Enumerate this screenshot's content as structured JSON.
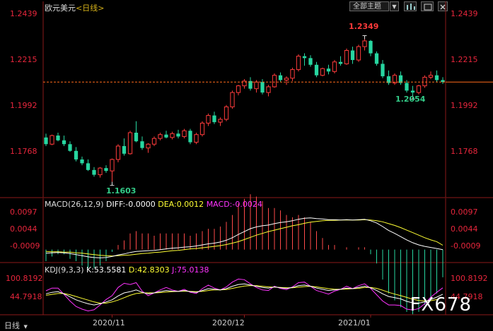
{
  "header": {
    "pair": "欧元美元",
    "period": "<日线>",
    "dropdown_label": "全部主题",
    "dropdown_arrow": "▼",
    "icons": [
      "chart-icon",
      "maximize-icon",
      "close-icon"
    ]
  },
  "chart_data": [
    {
      "type": "candlestick",
      "title": "欧元美元<日线>",
      "yticks": [
        "1.2439",
        "1.2215",
        "1.1992",
        "1.1768"
      ],
      "ylim": [
        1.155,
        1.248
      ],
      "current_price": 1.2125,
      "annotations": [
        {
          "label": "1.2349",
          "value": 1.2349,
          "color": "#ff3a3a"
        },
        {
          "label": "1.2054",
          "value": 1.2054,
          "color": "#33cc88"
        },
        {
          "label": "1.1603",
          "value": 1.1603,
          "color": "#33cc88"
        }
      ],
      "candles": [
        [
          1.1835,
          1.1855,
          1.179,
          1.18
        ],
        [
          1.18,
          1.185,
          1.1795,
          1.1845
        ],
        [
          1.1845,
          1.186,
          1.1815,
          1.182
        ],
        [
          1.182,
          1.1845,
          1.179,
          1.18
        ],
        [
          1.18,
          1.1815,
          1.176,
          1.1765
        ],
        [
          1.1765,
          1.1785,
          1.171,
          1.172
        ],
        [
          1.172,
          1.1735,
          1.169,
          1.17
        ],
        [
          1.17,
          1.172,
          1.166,
          1.1665
        ],
        [
          1.1665,
          1.168,
          1.163,
          1.164
        ],
        [
          1.164,
          1.168,
          1.1625,
          1.1675
        ],
        [
          1.1675,
          1.169,
          1.165,
          1.166
        ],
        [
          1.166,
          1.1725,
          1.1603,
          1.172
        ],
        [
          1.172,
          1.18,
          1.1705,
          1.179
        ],
        [
          1.179,
          1.183,
          1.174,
          1.175
        ],
        [
          1.175,
          1.187,
          1.1745,
          1.186
        ],
        [
          1.186,
          1.192,
          1.181,
          1.1815
        ],
        [
          1.1815,
          1.184,
          1.177,
          1.178
        ],
        [
          1.178,
          1.1805,
          1.1755,
          1.18
        ],
        [
          1.18,
          1.184,
          1.179,
          1.183
        ],
        [
          1.183,
          1.186,
          1.182,
          1.185
        ],
        [
          1.185,
          1.187,
          1.183,
          1.1835
        ],
        [
          1.1835,
          1.1865,
          1.1825,
          1.1855
        ],
        [
          1.1855,
          1.1875,
          1.183,
          1.184
        ],
        [
          1.184,
          1.188,
          1.183,
          1.187
        ],
        [
          1.187,
          1.188,
          1.18,
          1.181
        ],
        [
          1.181,
          1.186,
          1.18,
          1.185
        ],
        [
          1.185,
          1.192,
          1.184,
          1.191
        ],
        [
          1.191,
          1.196,
          1.1895,
          1.195
        ],
        [
          1.195,
          1.197,
          1.1905,
          1.1915
        ],
        [
          1.1915,
          1.194,
          1.1895,
          1.193
        ],
        [
          1.193,
          1.2005,
          1.192,
          1.1995
        ],
        [
          1.1995,
          1.208,
          1.1985,
          1.207
        ],
        [
          1.207,
          1.211,
          1.2055,
          1.2105
        ],
        [
          1.2105,
          1.214,
          1.209,
          1.213
        ],
        [
          1.213,
          1.215,
          1.208,
          1.209
        ],
        [
          1.209,
          1.2135,
          1.207,
          1.2125
        ],
        [
          1.2125,
          1.214,
          1.206,
          1.207
        ],
        [
          1.207,
          1.211,
          1.205,
          1.21
        ],
        [
          1.21,
          1.217,
          1.2095,
          1.216
        ],
        [
          1.216,
          1.2175,
          1.2125,
          1.2135
        ],
        [
          1.2135,
          1.2155,
          1.211,
          1.2145
        ],
        [
          1.2145,
          1.22,
          1.213,
          1.219
        ],
        [
          1.219,
          1.227,
          1.218,
          1.226
        ],
        [
          1.226,
          1.2275,
          1.221,
          1.225
        ],
        [
          1.225,
          1.2265,
          1.2205,
          1.2215
        ],
        [
          1.2215,
          1.223,
          1.215,
          1.216
        ],
        [
          1.216,
          1.22,
          1.2155,
          1.2195
        ],
        [
          1.2195,
          1.2215,
          1.2165,
          1.218
        ],
        [
          1.218,
          1.224,
          1.217,
          1.223
        ],
        [
          1.223,
          1.226,
          1.221,
          1.222
        ],
        [
          1.222,
          1.23,
          1.2215,
          1.229
        ],
        [
          1.229,
          1.231,
          1.222,
          1.224
        ],
        [
          1.224,
          1.232,
          1.223,
          1.231
        ],
        [
          1.231,
          1.2349,
          1.229,
          1.234
        ],
        [
          1.234,
          1.2345,
          1.226,
          1.2275
        ],
        [
          1.2275,
          1.2285,
          1.221,
          1.222
        ],
        [
          1.222,
          1.224,
          1.2145,
          1.2155
        ],
        [
          1.2155,
          1.2185,
          1.211,
          1.212
        ],
        [
          1.212,
          1.217,
          1.211,
          1.216
        ],
        [
          1.216,
          1.218,
          1.211,
          1.212
        ],
        [
          1.212,
          1.2135,
          1.207,
          1.208
        ],
        [
          1.208,
          1.2105,
          1.2054,
          1.207
        ],
        [
          1.207,
          1.211,
          1.206,
          1.2105
        ],
        [
          1.2105,
          1.216,
          1.2095,
          1.215
        ],
        [
          1.215,
          1.218,
          1.214,
          1.216
        ],
        [
          1.216,
          1.2185,
          1.2125,
          1.2135
        ],
        [
          1.2135,
          1.215,
          1.2115,
          1.2125
        ]
      ]
    },
    {
      "type": "line",
      "title": "MACD(26,12,9)",
      "legend": [
        {
          "label": "DIFF:-0.0000",
          "color": "#ffffff"
        },
        {
          "label": "DEA:0.0012",
          "color": "#ffff33"
        },
        {
          "label": "MACD:-0.0024",
          "color": "#ff33ff"
        }
      ],
      "yticks": [
        "0.0097",
        "0.0044",
        "-0.0009"
      ],
      "ylim": [
        -0.0032,
        0.0107
      ],
      "diff": [
        -0.001,
        -0.0009,
        -0.0008,
        -0.0009,
        -0.0011,
        -0.0014,
        -0.0017,
        -0.002,
        -0.0022,
        -0.0023,
        -0.0022,
        -0.0019,
        -0.0015,
        -0.0012,
        -0.0008,
        -0.0005,
        -0.0004,
        -0.0003,
        -0.0002,
        0.0,
        0.0002,
        0.0004,
        0.0005,
        0.0007,
        0.0008,
        0.001,
        0.0013,
        0.0016,
        0.0018,
        0.0021,
        0.0026,
        0.0033,
        0.0042,
        0.005,
        0.0058,
        0.0063,
        0.0066,
        0.0068,
        0.0072,
        0.0075,
        0.0077,
        0.008,
        0.0084,
        0.0087,
        0.0088,
        0.0086,
        0.0085,
        0.0083,
        0.0083,
        0.0082,
        0.0083,
        0.0082,
        0.0083,
        0.0084,
        0.008,
        0.0074,
        0.0064,
        0.0053,
        0.0045,
        0.0036,
        0.0027,
        0.0019,
        0.0013,
        0.0009,
        0.0006,
        0.0003,
        0.0
      ],
      "dea": [
        -0.0005,
        -0.0006,
        -0.0006,
        -0.0007,
        -0.0007,
        -0.0009,
        -0.001,
        -0.0012,
        -0.0014,
        -0.0016,
        -0.0017,
        -0.0018,
        -0.0017,
        -0.0016,
        -0.0015,
        -0.0013,
        -0.0011,
        -0.001,
        -0.0008,
        -0.0007,
        -0.0005,
        -0.0003,
        -0.0002,
        0.0,
        0.0002,
        0.0003,
        0.0005,
        0.0007,
        0.0009,
        0.0011,
        0.0014,
        0.0018,
        0.0022,
        0.0028,
        0.0034,
        0.004,
        0.0045,
        0.005,
        0.0054,
        0.0058,
        0.0062,
        0.0066,
        0.0069,
        0.0073,
        0.0076,
        0.0078,
        0.008,
        0.0081,
        0.0081,
        0.0082,
        0.0082,
        0.0082,
        0.0082,
        0.0083,
        0.0082,
        0.008,
        0.0077,
        0.0072,
        0.0067,
        0.0061,
        0.0054,
        0.0047,
        0.004,
        0.0033,
        0.0027,
        0.0022,
        0.0012
      ],
      "hist_note": "MACD histogram = 2*(DIFF-DEA)"
    },
    {
      "type": "line",
      "title": "KDJ(9,3,3)",
      "legend": [
        {
          "label": "K:53.5581",
          "color": "#ffffff"
        },
        {
          "label": "D:42.8303",
          "color": "#ffff33"
        },
        {
          "label": "J:75.0138",
          "color": "#ff33ff"
        }
      ],
      "yticks": [
        "100.8192",
        "44.7918"
      ],
      "ylim": [
        -10,
        112
      ],
      "k": [
        55,
        60,
        62,
        55,
        45,
        35,
        28,
        22,
        18,
        22,
        28,
        35,
        48,
        58,
        62,
        68,
        60,
        55,
        58,
        62,
        66,
        64,
        63,
        66,
        62,
        60,
        66,
        72,
        70,
        68,
        72,
        80,
        86,
        88,
        84,
        80,
        76,
        74,
        78,
        75,
        73,
        76,
        82,
        84,
        80,
        74,
        70,
        66,
        68,
        70,
        74,
        72,
        76,
        80,
        75,
        66,
        55,
        46,
        42,
        38,
        30,
        25,
        24,
        28,
        36,
        44,
        53.5581
      ],
      "d": [
        50,
        53,
        56,
        56,
        52,
        46,
        40,
        34,
        28,
        24,
        24,
        28,
        34,
        42,
        50,
        56,
        58,
        58,
        58,
        59,
        61,
        62,
        63,
        64,
        63,
        62,
        63,
        66,
        68,
        68,
        69,
        73,
        77,
        81,
        82,
        82,
        80,
        78,
        77,
        76,
        75,
        75,
        77,
        79,
        80,
        78,
        75,
        72,
        70,
        70,
        71,
        72,
        73,
        76,
        76,
        73,
        67,
        60,
        54,
        49,
        43,
        37,
        33,
        31,
        32,
        36,
        42.8303
      ],
      "j": [
        65,
        74,
        74,
        53,
        31,
        13,
        4,
        -2,
        2,
        18,
        36,
        49,
        76,
        90,
        86,
        92,
        64,
        49,
        58,
        68,
        76,
        68,
        63,
        70,
        60,
        56,
        72,
        84,
        74,
        68,
        78,
        94,
        104,
        102,
        88,
        76,
        68,
        66,
        80,
        73,
        69,
        78,
        92,
        94,
        80,
        66,
        60,
        54,
        64,
        70,
        80,
        72,
        82,
        88,
        73,
        52,
        31,
        18,
        18,
        16,
        4,
        1,
        6,
        22,
        44,
        60,
        75.0138
      ]
    }
  ],
  "xaxis": {
    "labels": [
      {
        "text": "2020/11",
        "index": 11
      },
      {
        "text": "2020/12",
        "index": 33
      },
      {
        "text": "2021/01",
        "index": 54
      }
    ],
    "period_button": "日线"
  },
  "watermark": "FX678"
}
